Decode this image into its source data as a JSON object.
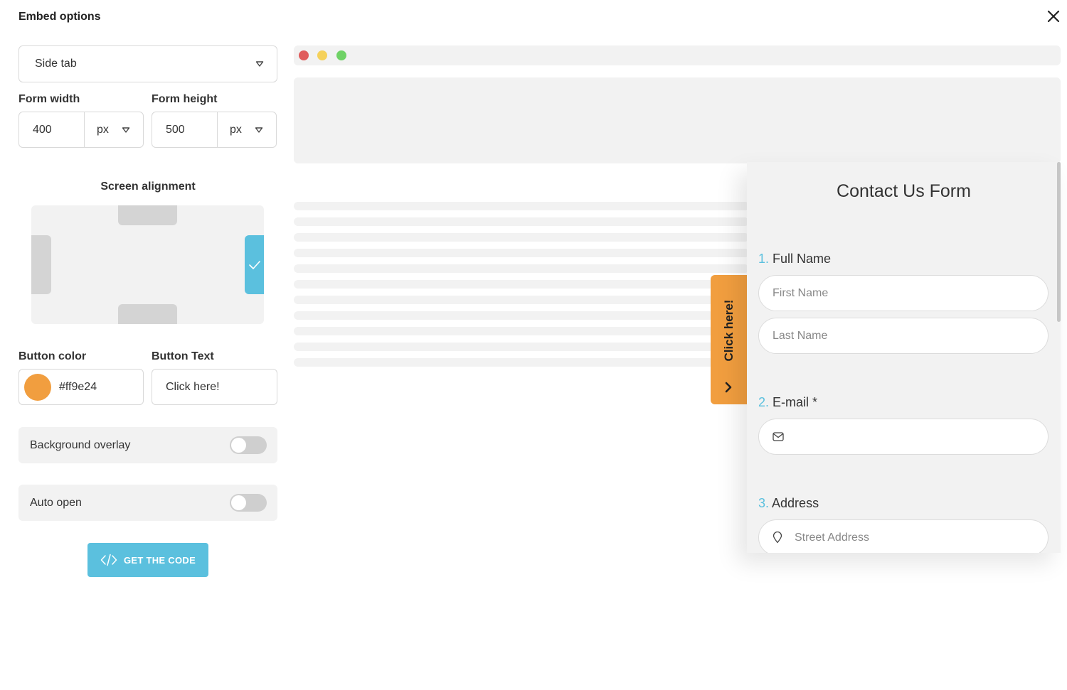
{
  "header": {
    "title": "Embed options"
  },
  "embed_type": {
    "value": "Side tab"
  },
  "dimensions": {
    "width_label": "Form width",
    "width_value": "400",
    "width_unit": "px",
    "height_label": "Form height",
    "height_value": "500",
    "height_unit": "px"
  },
  "alignment": {
    "label": "Screen alignment",
    "selected": "right"
  },
  "button": {
    "color_label": "Button color",
    "color_value": "#ff9e24",
    "text_label": "Button Text",
    "text_value": "Click here!"
  },
  "toggles": {
    "background_overlay": {
      "label": "Background overlay",
      "on": false
    },
    "auto_open": {
      "label": "Auto open",
      "on": false
    }
  },
  "get_code": {
    "label": "GET THE CODE"
  },
  "preview": {
    "side_tab_text": "Click here!",
    "form": {
      "title": "Contact Us Form",
      "questions": [
        {
          "num": "1.",
          "label": "Full Name"
        },
        {
          "num": "2.",
          "label": "E-mail *"
        },
        {
          "num": "3.",
          "label": "Address"
        }
      ],
      "first_name_placeholder": "First Name",
      "last_name_placeholder": "Last Name",
      "street_placeholder": "Street Address"
    }
  },
  "colors": {
    "accent": "#5bc0de",
    "tab": "#f19e3f",
    "dot_red": "#e05c5c",
    "dot_yellow": "#f5d15a",
    "dot_green": "#6fd266"
  }
}
